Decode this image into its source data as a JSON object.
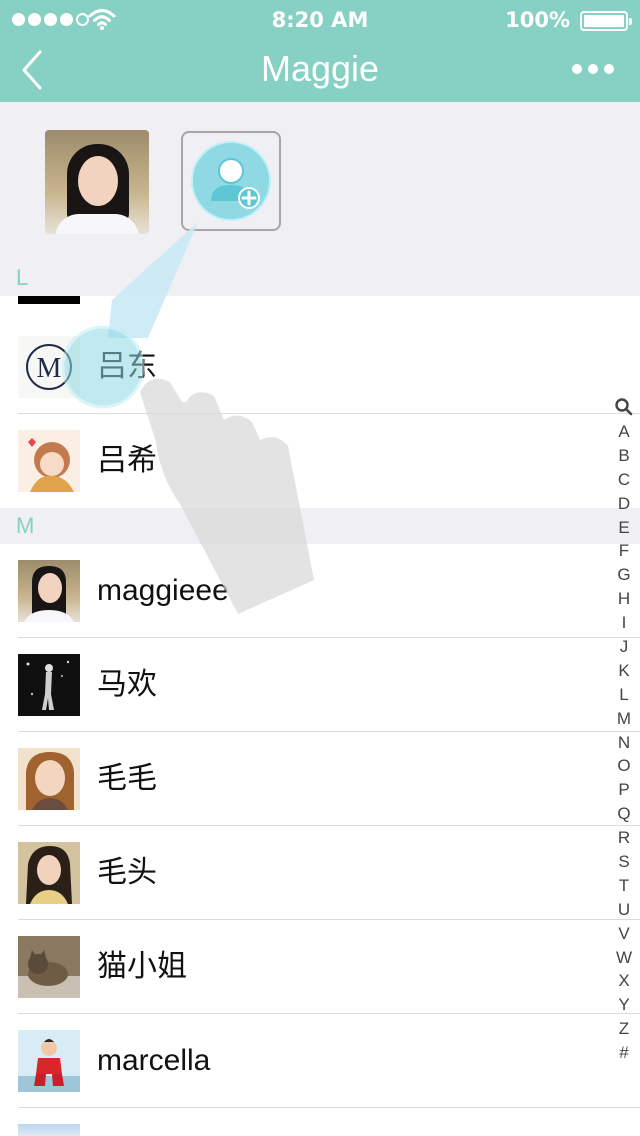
{
  "status_bar": {
    "time": "8:20 AM",
    "battery": "100%"
  },
  "nav": {
    "title": "Maggie"
  },
  "sections": [
    {
      "letter": "L",
      "contacts": [
        {
          "name": ""
        },
        {
          "name": "吕东"
        },
        {
          "name": "吕希"
        }
      ]
    },
    {
      "letter": "M",
      "contacts": [
        {
          "name": "maggieee"
        },
        {
          "name": "马欢"
        },
        {
          "name": "毛毛"
        },
        {
          "name": "毛头"
        },
        {
          "name": "猫小姐"
        },
        {
          "name": "marcella"
        }
      ]
    }
  ],
  "index_bar": {
    "letters": [
      "A",
      "B",
      "C",
      "D",
      "E",
      "F",
      "G",
      "H",
      "I",
      "J",
      "K",
      "L",
      "M",
      "N",
      "O",
      "P",
      "Q",
      "R",
      "S",
      "T",
      "U",
      "V",
      "W",
      "X",
      "Y",
      "Z",
      "#"
    ]
  },
  "colors": {
    "accent": "#86d1c3",
    "highlight": "#8ed9e4"
  }
}
